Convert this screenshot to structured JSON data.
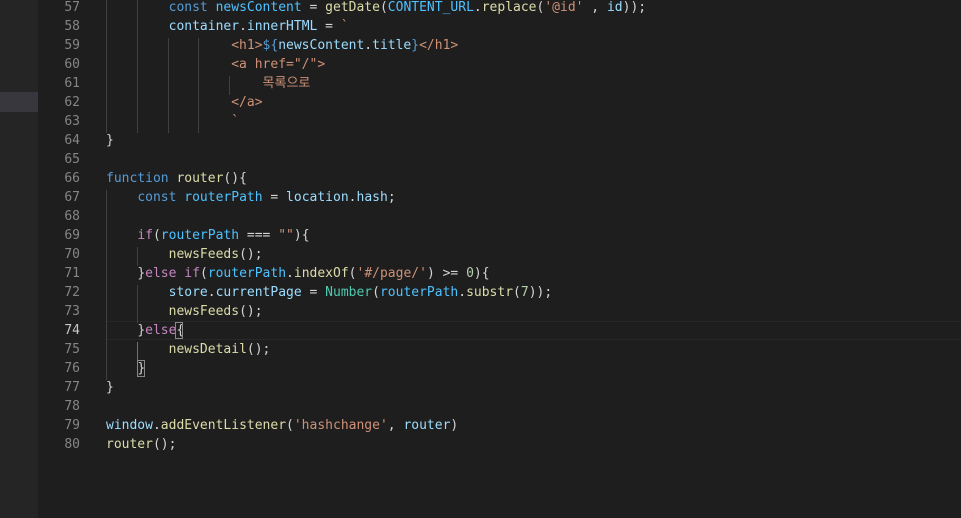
{
  "editor": {
    "active_line": "74",
    "lines": [
      {
        "n": "57",
        "tokens": [
          {
            "t": "        ",
            "c": "plain"
          },
          {
            "t": "const ",
            "c": "kw"
          },
          {
            "t": "newsContent",
            "c": "const"
          },
          {
            "t": " = ",
            "c": "plain"
          },
          {
            "t": "getDate",
            "c": "fn"
          },
          {
            "t": "(",
            "c": "plain"
          },
          {
            "t": "CONTENT_URL",
            "c": "const"
          },
          {
            "t": ".",
            "c": "plain"
          },
          {
            "t": "replace",
            "c": "fn"
          },
          {
            "t": "(",
            "c": "plain"
          },
          {
            "t": "'@id'",
            "c": "str"
          },
          {
            "t": " , ",
            "c": "plain"
          },
          {
            "t": "id",
            "c": "var"
          },
          {
            "t": "));",
            "c": "plain"
          }
        ]
      },
      {
        "n": "58",
        "tokens": [
          {
            "t": "        ",
            "c": "plain"
          },
          {
            "t": "container",
            "c": "var"
          },
          {
            "t": ".",
            "c": "plain"
          },
          {
            "t": "innerHTML",
            "c": "var"
          },
          {
            "t": " = ",
            "c": "plain"
          },
          {
            "t": "`",
            "c": "str"
          }
        ]
      },
      {
        "n": "59",
        "tokens": [
          {
            "t": "                ",
            "c": "plain"
          },
          {
            "t": "<h1>",
            "c": "str"
          },
          {
            "t": "${",
            "c": "kw"
          },
          {
            "t": "newsContent",
            "c": "var"
          },
          {
            "t": ".",
            "c": "plain"
          },
          {
            "t": "title",
            "c": "var"
          },
          {
            "t": "}",
            "c": "kw"
          },
          {
            "t": "</h1>",
            "c": "str"
          }
        ]
      },
      {
        "n": "60",
        "tokens": [
          {
            "t": "                ",
            "c": "plain"
          },
          {
            "t": "<a href=\"/\">",
            "c": "str"
          }
        ]
      },
      {
        "n": "61",
        "tokens": [
          {
            "t": "                    ",
            "c": "plain"
          },
          {
            "t": "목록으로",
            "c": "str"
          }
        ]
      },
      {
        "n": "62",
        "tokens": [
          {
            "t": "                ",
            "c": "plain"
          },
          {
            "t": "</a>",
            "c": "str"
          }
        ]
      },
      {
        "n": "63",
        "tokens": [
          {
            "t": "                ",
            "c": "plain"
          },
          {
            "t": "`",
            "c": "str"
          }
        ]
      },
      {
        "n": "64",
        "tokens": [
          {
            "t": "}",
            "c": "plain"
          }
        ]
      },
      {
        "n": "65",
        "tokens": []
      },
      {
        "n": "66",
        "tokens": [
          {
            "t": "function ",
            "c": "kw"
          },
          {
            "t": "router",
            "c": "fn"
          },
          {
            "t": "(){",
            "c": "plain"
          }
        ]
      },
      {
        "n": "67",
        "tokens": [
          {
            "t": "    ",
            "c": "plain"
          },
          {
            "t": "const ",
            "c": "kw"
          },
          {
            "t": "routerPath",
            "c": "const"
          },
          {
            "t": " = ",
            "c": "plain"
          },
          {
            "t": "location",
            "c": "var"
          },
          {
            "t": ".",
            "c": "plain"
          },
          {
            "t": "hash",
            "c": "var"
          },
          {
            "t": ";",
            "c": "plain"
          }
        ]
      },
      {
        "n": "68",
        "tokens": []
      },
      {
        "n": "69",
        "tokens": [
          {
            "t": "    ",
            "c": "plain"
          },
          {
            "t": "if",
            "c": "ctl"
          },
          {
            "t": "(",
            "c": "plain"
          },
          {
            "t": "routerPath",
            "c": "const"
          },
          {
            "t": " === ",
            "c": "plain"
          },
          {
            "t": "\"\"",
            "c": "str"
          },
          {
            "t": "){",
            "c": "plain"
          }
        ]
      },
      {
        "n": "70",
        "tokens": [
          {
            "t": "        ",
            "c": "plain"
          },
          {
            "t": "newsFeeds",
            "c": "fn"
          },
          {
            "t": "();",
            "c": "plain"
          }
        ]
      },
      {
        "n": "71",
        "tokens": [
          {
            "t": "    ",
            "c": "plain"
          },
          {
            "t": "}",
            "c": "plain"
          },
          {
            "t": "else ",
            "c": "ctl"
          },
          {
            "t": "if",
            "c": "ctl"
          },
          {
            "t": "(",
            "c": "plain"
          },
          {
            "t": "routerPath",
            "c": "const"
          },
          {
            "t": ".",
            "c": "plain"
          },
          {
            "t": "indexOf",
            "c": "fn"
          },
          {
            "t": "(",
            "c": "plain"
          },
          {
            "t": "'#/page/'",
            "c": "str"
          },
          {
            "t": ") >= ",
            "c": "plain"
          },
          {
            "t": "0",
            "c": "num"
          },
          {
            "t": "){",
            "c": "plain"
          }
        ]
      },
      {
        "n": "72",
        "tokens": [
          {
            "t": "        ",
            "c": "plain"
          },
          {
            "t": "store",
            "c": "var"
          },
          {
            "t": ".",
            "c": "plain"
          },
          {
            "t": "currentPage",
            "c": "var"
          },
          {
            "t": " = ",
            "c": "plain"
          },
          {
            "t": "Number",
            "c": "cls"
          },
          {
            "t": "(",
            "c": "plain"
          },
          {
            "t": "routerPath",
            "c": "const"
          },
          {
            "t": ".",
            "c": "plain"
          },
          {
            "t": "substr",
            "c": "fn"
          },
          {
            "t": "(",
            "c": "plain"
          },
          {
            "t": "7",
            "c": "num"
          },
          {
            "t": "));",
            "c": "plain"
          }
        ]
      },
      {
        "n": "73",
        "tokens": [
          {
            "t": "        ",
            "c": "plain"
          },
          {
            "t": "newsFeeds",
            "c": "fn"
          },
          {
            "t": "();",
            "c": "plain"
          }
        ]
      },
      {
        "n": "74",
        "tokens": [
          {
            "t": "    ",
            "c": "plain"
          },
          {
            "t": "}",
            "c": "plain"
          },
          {
            "t": "else",
            "c": "ctl"
          },
          {
            "t": "{",
            "c": "plain"
          }
        ]
      },
      {
        "n": "75",
        "tokens": [
          {
            "t": "        ",
            "c": "plain"
          },
          {
            "t": "newsDetail",
            "c": "fn"
          },
          {
            "t": "();",
            "c": "plain"
          }
        ]
      },
      {
        "n": "76",
        "tokens": [
          {
            "t": "    ",
            "c": "plain"
          },
          {
            "t": "}",
            "c": "plain"
          }
        ]
      },
      {
        "n": "77",
        "tokens": [
          {
            "t": "}",
            "c": "plain"
          }
        ]
      },
      {
        "n": "78",
        "tokens": []
      },
      {
        "n": "79",
        "tokens": [
          {
            "t": "window",
            "c": "var"
          },
          {
            "t": ".",
            "c": "plain"
          },
          {
            "t": "addEventListener",
            "c": "fn"
          },
          {
            "t": "(",
            "c": "plain"
          },
          {
            "t": "'hashchange'",
            "c": "str"
          },
          {
            "t": ", ",
            "c": "plain"
          },
          {
            "t": "router",
            "c": "var"
          },
          {
            "t": ")",
            "c": "plain"
          }
        ]
      },
      {
        "n": "80",
        "tokens": [
          {
            "t": "router",
            "c": "fn"
          },
          {
            "t": "();",
            "c": "plain"
          }
        ]
      }
    ]
  }
}
